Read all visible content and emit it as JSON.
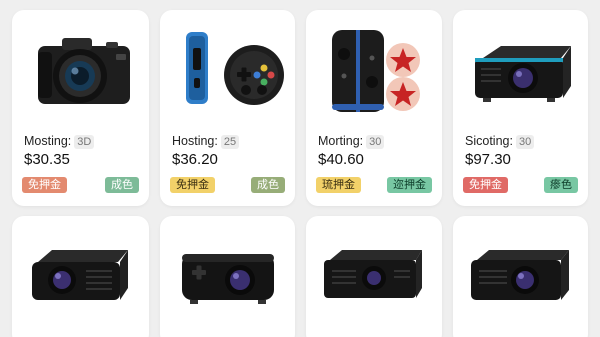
{
  "products": [
    {
      "name": "Mosting:",
      "count": "3D",
      "price": "$30.35",
      "tag_left": "免押金",
      "tag_right": "成色",
      "icon": "camera-icon"
    },
    {
      "name": "Hosting:",
      "count": "25",
      "price": "$36.20",
      "tag_left": "免押金",
      "tag_right": "成色",
      "icon": "game-controller-icon"
    },
    {
      "name": "Morting:",
      "count": "30",
      "price": "$40.60",
      "tag_left": "琉押金",
      "tag_right": "迩押金",
      "icon": "joycon-controller-icon"
    },
    {
      "name": "Sicoting:",
      "count": "30",
      "price": "$97.30",
      "tag_left": "免押金",
      "tag_right": "瘆色",
      "icon": "projector-icon"
    }
  ],
  "bottom_products": [
    {
      "icon": "projector-icon"
    },
    {
      "icon": "projector-icon"
    },
    {
      "icon": "projector-icon"
    },
    {
      "icon": "projector-icon"
    }
  ],
  "colors": {
    "background": "#efefef",
    "card": "#ffffff",
    "tag_salmon": "#e38a6f",
    "tag_yellow": "#f2d169",
    "tag_red": "#e06a66",
    "tag_green": "#7dbb98",
    "tag_olive": "#97ad78",
    "tag_teal": "#78c7a3"
  }
}
